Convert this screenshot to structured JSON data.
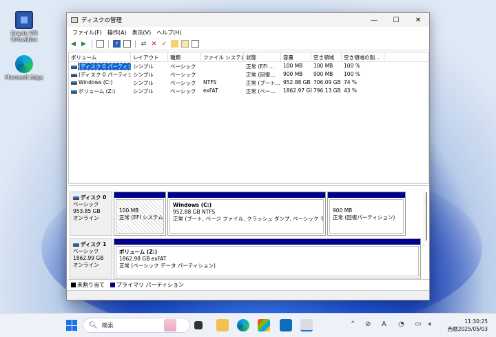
{
  "desktop": {
    "icons": [
      {
        "label_line1": "Oracle VM",
        "label_line2": "VirtualBox"
      },
      {
        "label_line1": "Microsoft Edge",
        "label_line2": ""
      }
    ]
  },
  "window": {
    "title": "ディスクの管理",
    "controls": {
      "minimize": "—",
      "maximize": "☐",
      "close": "✕"
    },
    "menu": [
      "ファイル(F)",
      "操作(A)",
      "表示(V)",
      "ヘルプ(H)"
    ]
  },
  "volume_list": {
    "columns": [
      "ボリューム",
      "レイアウト",
      "種類",
      "ファイル システム",
      "状態",
      "容量",
      "空き領域",
      "空き領域の割..."
    ],
    "rows": [
      [
        "(ディスク 0 パーティシ...",
        "シンプル",
        "ベーシック",
        "",
        "正常 (EFI ...",
        "100 MB",
        "100 MB",
        "100 %"
      ],
      [
        "(ディスク 0 パーティシ...",
        "シンプル",
        "ベーシック",
        "",
        "正常 (回復...",
        "900 MB",
        "900 MB",
        "100 %"
      ],
      [
        "Windows (C:)",
        "シンプル",
        "ベーシック",
        "NTFS",
        "正常 (ブート...",
        "952.88 GB",
        "706.09 GB",
        "74 %"
      ],
      [
        "ボリューム (Z:)",
        "シンプル",
        "ベーシック",
        "exFAT",
        "正常 (ベー...",
        "1862.97 GB",
        "796.13 GB",
        "43 %"
      ]
    ]
  },
  "disks": [
    {
      "name": "ディスク 0",
      "type": "ベーシック",
      "size": "953.85 GB",
      "status": "オンライン",
      "partitions": [
        {
          "name": "",
          "line1": "100 MB",
          "line2": "正常 (EFI システム パ"
        },
        {
          "name": "Windows  (C:)",
          "line1": "952.88 GB NTFS",
          "line2": "正常 (ブート, ページ ファイル, クラッシュ ダンプ, ベーシック データ パーテ"
        },
        {
          "name": "",
          "line1": "900 MB",
          "line2": "正常 (回復パーティション)"
        }
      ]
    },
    {
      "name": "ディスク 1",
      "type": "ベーシック",
      "size": "1862.99 GB",
      "status": "オンライン",
      "partitions": [
        {
          "name": "ボリューム  (Z:)",
          "line1": "1862.98 GB exFAT",
          "line2": "正常 (ベーシック データ パーティション)"
        }
      ]
    }
  ],
  "legend": {
    "unallocated": "未割り当て",
    "primary": "プライマリ パーティション"
  },
  "colors": {
    "primary_partition": "#00008b",
    "unallocated": "#000000",
    "selection": "#0a64d6"
  },
  "taskbar": {
    "search_placeholder": "検索",
    "time": "11:30:25",
    "date": "西暦2025/05/03"
  }
}
